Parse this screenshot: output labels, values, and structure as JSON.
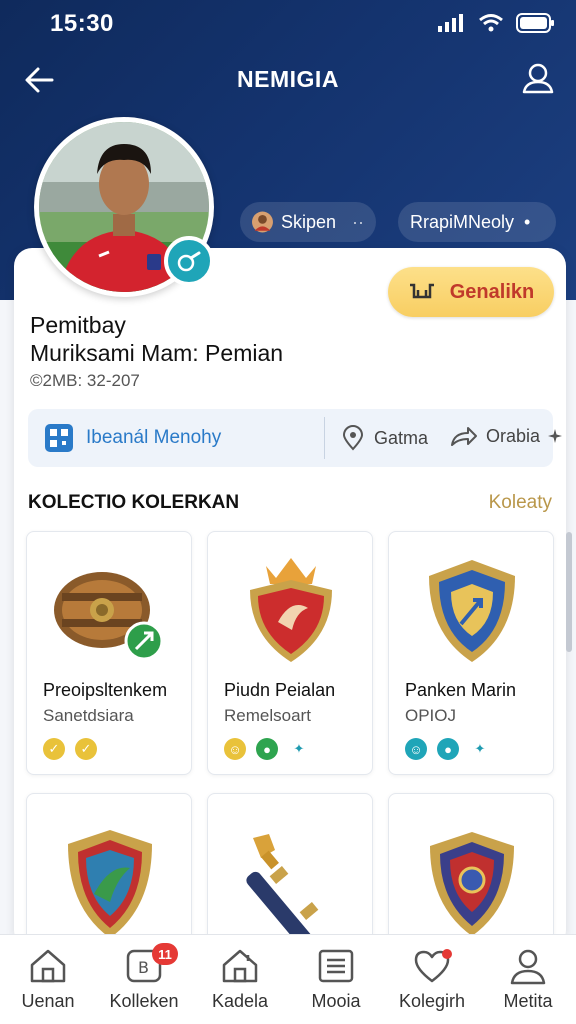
{
  "status_bar": {
    "time": "15:30",
    "icons": [
      "signal-icon",
      "wifi-icon",
      "battery-icon"
    ]
  },
  "nav": {
    "title": "NEMIGIA",
    "back_icon": "arrow-left-icon",
    "profile_icon": "user-outline-icon"
  },
  "chips": [
    {
      "label": "Skipen",
      "icon": "avatar-small-icon",
      "extra": "··"
    },
    {
      "label": "RrapiMNeoly",
      "extra": "•"
    }
  ],
  "profile": {
    "name_line1": "Pemitbay",
    "name_line2": "Muriksami Mam: Pemian",
    "subtitle": "©2MB: 32-207",
    "badge_icon": "whistle-icon"
  },
  "cta": {
    "label": "Genalikn",
    "icon": "cart-icon"
  },
  "info_bar": {
    "left_label": "Ibeanál Menohy",
    "left_icon": "qr-icon",
    "mid_label": "Gatma",
    "mid_icon": "location-pin-icon",
    "right_label": "Orabia",
    "right_icon": "share-arrow-icon"
  },
  "collection": {
    "title": "KOLECTIO KOLERKAN",
    "link": "Koleaty",
    "items": [
      {
        "name": "Preoipsltenkem",
        "sub": "Sanetdsiara",
        "art": "leather-bracer-icon",
        "badges": [
          "#e9c23a",
          "#e9c23a"
        ]
      },
      {
        "name": "Piudn Peialan",
        "sub": "Remelsoart",
        "art": "red-shield-crest-icon",
        "badges": [
          "#e9c23a",
          "#2ea44f",
          "#1f9bb0"
        ]
      },
      {
        "name": "Panken Marin",
        "sub": "OPIOJ",
        "art": "blue-shield-icon",
        "badges": [
          "#1fa5b8",
          "#1fa5b8",
          "#1f9bb0"
        ]
      },
      {
        "name": "",
        "sub": "",
        "art": "green-shield-icon",
        "badges": []
      },
      {
        "name": "",
        "sub": "",
        "art": "golden-baton-icon",
        "badges": []
      },
      {
        "name": "",
        "sub": "",
        "art": "dark-shield-icon",
        "badges": []
      }
    ]
  },
  "tabs": [
    {
      "label": "Uenan",
      "icon": "home-icon"
    },
    {
      "label": "Kolleken",
      "icon": "collection-icon",
      "badge": "11"
    },
    {
      "label": "Kadela",
      "icon": "house-icon"
    },
    {
      "label": "Mooia",
      "icon": "list-icon"
    },
    {
      "label": "Kolegirh",
      "icon": "heart-icon",
      "dot": true
    },
    {
      "label": "Metita",
      "icon": "person-icon"
    }
  ],
  "colors": {
    "header": "#14336e",
    "accent": "#1fa5b8",
    "cta": "#f8ce62",
    "cta_text": "#c0392b",
    "link": "#b9974a"
  }
}
